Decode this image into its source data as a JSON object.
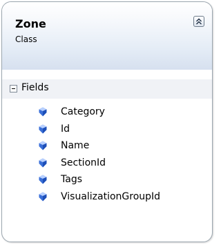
{
  "class_shape": {
    "name": "Zone",
    "stereotype": "Class",
    "collapse_icon": "double-chevron-up-icon",
    "sections": [
      {
        "label": "Fields",
        "expanded": true,
        "field_icon": "field-gem-icon",
        "members": [
          "Category",
          "Id",
          "Name",
          "SectionId",
          "Tags",
          "VisualizationGroupId"
        ]
      }
    ]
  },
  "colors": {
    "header_gradient_bottom": "#d6e0ef",
    "border": "#9aa5ae",
    "section_bar": "#f0f2f6",
    "field_icon": "#3a6fd8"
  }
}
